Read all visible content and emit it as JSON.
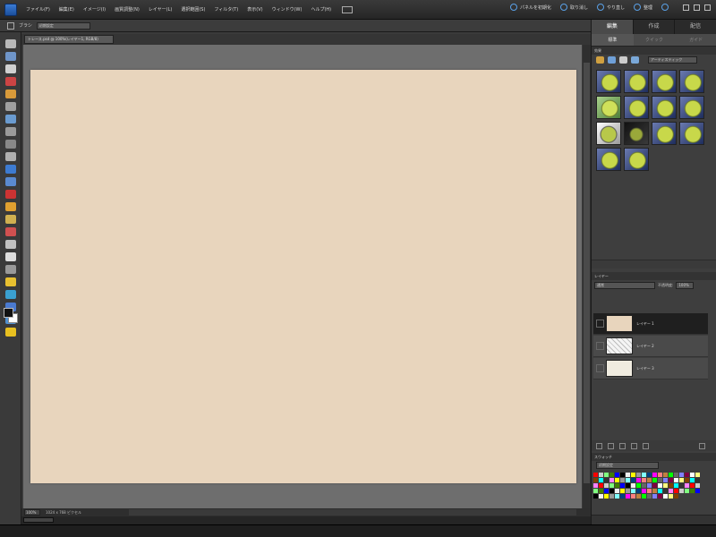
{
  "menubar": {
    "items": [
      "ファイル(F)",
      "編集(E)",
      "イメージ(I)",
      "画質調整(N)",
      "レイヤー(L)",
      "選択範囲(S)",
      "フィルタ(T)",
      "表示(V)",
      "ウィンドウ(W)",
      "ヘルプ(H)"
    ],
    "right": {
      "panel_reset": "パネルを初期化",
      "undo": "取り消し",
      "redo": "やり直し",
      "organizer": "整理"
    }
  },
  "options": {
    "label": "ブラシ",
    "preset_value": "初期設定"
  },
  "document": {
    "tab_title": "トレース.psd @ 100%(レイヤー1, RGB/8)",
    "zoom": "100%",
    "status": "1024 x 768 ピクセル",
    "canvas_color": "#e8d5bd"
  },
  "panel": {
    "tabs": [
      "編集",
      "作成",
      "配信"
    ],
    "subtabs": [
      "標準",
      "クイック",
      "ガイド"
    ],
    "effects": {
      "header": "効果",
      "filter_select": "アーティスティック"
    },
    "layers": {
      "header": "レイヤー",
      "blend_mode": "通常",
      "opacity_label": "不透明度:",
      "opacity_value": "100%",
      "items": [
        {
          "name": "レイヤー 1",
          "thumb_color": "#e8d5bd"
        },
        {
          "name": "レイヤー 2",
          "thumb_color": "#f4f4f4"
        },
        {
          "name": "レイヤー 3",
          "thumb_color": "#f0ece0"
        }
      ]
    },
    "swatches": {
      "header": "スウォッチ",
      "set": "初期設定"
    }
  },
  "colors": {
    "canvas": "#e8d5bd",
    "accent": "#3a7bd5"
  }
}
